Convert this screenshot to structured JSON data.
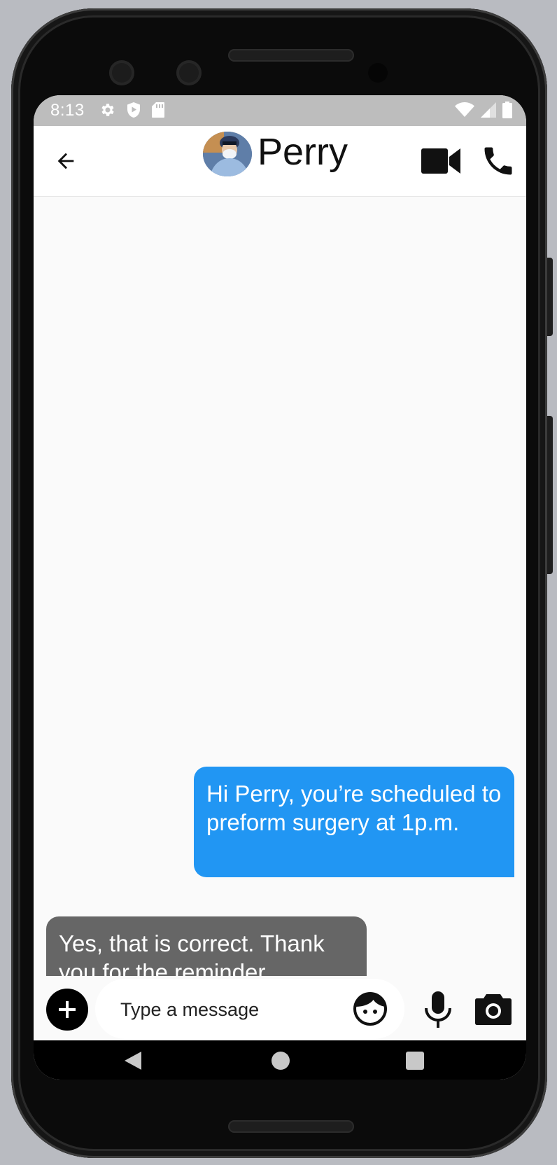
{
  "status_bar": {
    "time": "8:13",
    "left_icons": [
      "settings-icon",
      "shield-icon",
      "sd-card-icon"
    ],
    "right_icons": [
      "wifi-icon",
      "cell-signal-icon",
      "battery-icon"
    ]
  },
  "app_bar": {
    "contact_name": "Perry",
    "actions": [
      "video-call-icon",
      "phone-call-icon"
    ]
  },
  "messages": [
    {
      "direction": "sent",
      "text": "Hi Perry, you’re scheduled to preform surgery at 1p.m."
    },
    {
      "direction": "received",
      "text": "Yes, that is correct. Thank you for the reminder."
    }
  ],
  "composer": {
    "placeholder": "Type a message",
    "value": "",
    "icons": [
      "add-icon",
      "emoji-icon",
      "microphone-icon",
      "camera-icon"
    ]
  },
  "colors": {
    "sent_bubble": "#2196f3",
    "received_bubble": "#666666",
    "status_bar": "#bdbdbd",
    "chat_background": "#fafafa"
  }
}
